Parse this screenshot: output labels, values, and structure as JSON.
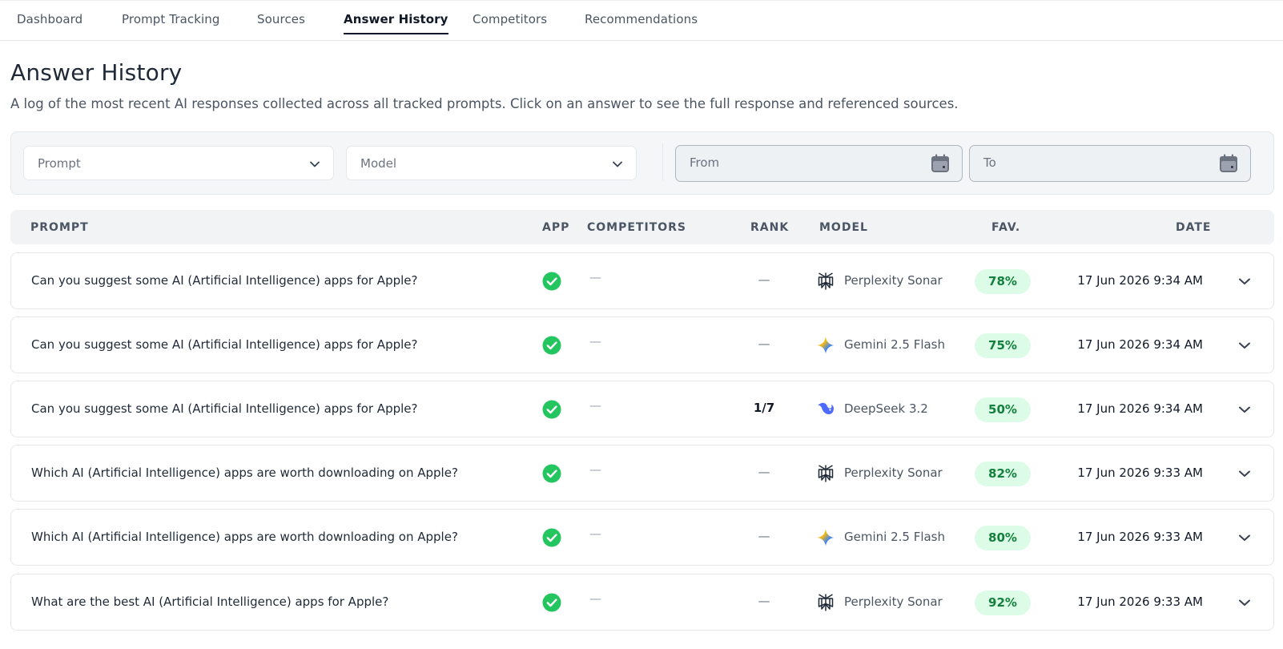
{
  "nav": {
    "tabs": [
      {
        "label": "Dashboard"
      },
      {
        "label": "Prompt Tracking"
      },
      {
        "label": "Sources"
      },
      {
        "label": "Answer History",
        "active": true
      },
      {
        "label": "Competitors"
      },
      {
        "label": "Recommendations"
      }
    ]
  },
  "page": {
    "title": "Answer History",
    "subtitle": "A log of the most recent AI responses collected across all tracked prompts. Click on an answer to see the full response and referenced sources."
  },
  "filters": {
    "prompt_placeholder": "Prompt",
    "model_placeholder": "Model",
    "from_placeholder": "From",
    "to_placeholder": "To"
  },
  "table": {
    "headers": {
      "prompt": "PROMPT",
      "app": "APP",
      "competitors": "COMPETITORS",
      "rank": "RANK",
      "model": "MODEL",
      "fav": "FAV.",
      "date": "DATE"
    },
    "rows": [
      {
        "prompt": "Can you suggest some AI (Artificial Intelligence) apps for Apple?",
        "app": "check-circle-icon",
        "competitors": "—",
        "rank": "—",
        "model": "Perplexity Sonar",
        "model_icon": "perplexity-icon",
        "fav": "78%",
        "date": "17 Jun 2026 9:34 AM"
      },
      {
        "prompt": "Can you suggest some AI (Artificial Intelligence) apps for Apple?",
        "app": "check-circle-icon",
        "competitors": "—",
        "rank": "—",
        "model": "Gemini 2.5 Flash",
        "model_icon": "gemini-icon",
        "fav": "75%",
        "date": "17 Jun 2026 9:34 AM"
      },
      {
        "prompt": "Can you suggest some AI (Artificial Intelligence) apps for Apple?",
        "app": "check-circle-icon",
        "competitors": "—",
        "rank": "1/7",
        "model": "DeepSeek 3.2",
        "model_icon": "deepseek-icon",
        "fav": "50%",
        "date": "17 Jun 2026 9:34 AM"
      },
      {
        "prompt": "Which AI (Artificial Intelligence) apps are worth downloading on Apple?",
        "app": "check-circle-icon",
        "competitors": "—",
        "rank": "—",
        "model": "Perplexity Sonar",
        "model_icon": "perplexity-icon",
        "fav": "82%",
        "date": "17 Jun 2026 9:33 AM"
      },
      {
        "prompt": "Which AI (Artificial Intelligence) apps are worth downloading on Apple?",
        "app": "check-circle-icon",
        "competitors": "—",
        "rank": "—",
        "model": "Gemini 2.5 Flash",
        "model_icon": "gemini-icon",
        "fav": "80%",
        "date": "17 Jun 2026 9:33 AM"
      },
      {
        "prompt": "What are the best AI (Artificial Intelligence) apps for Apple?",
        "app": "check-circle-icon",
        "competitors": "—",
        "rank": "—",
        "model": "Perplexity Sonar",
        "model_icon": "perplexity-icon",
        "fav": "92%",
        "date": "17 Jun 2026 9:33 AM"
      }
    ]
  },
  "colors": {
    "accent_green": "#22c55e",
    "fav_bg": "#dcfce7",
    "fav_text": "#15803d"
  }
}
